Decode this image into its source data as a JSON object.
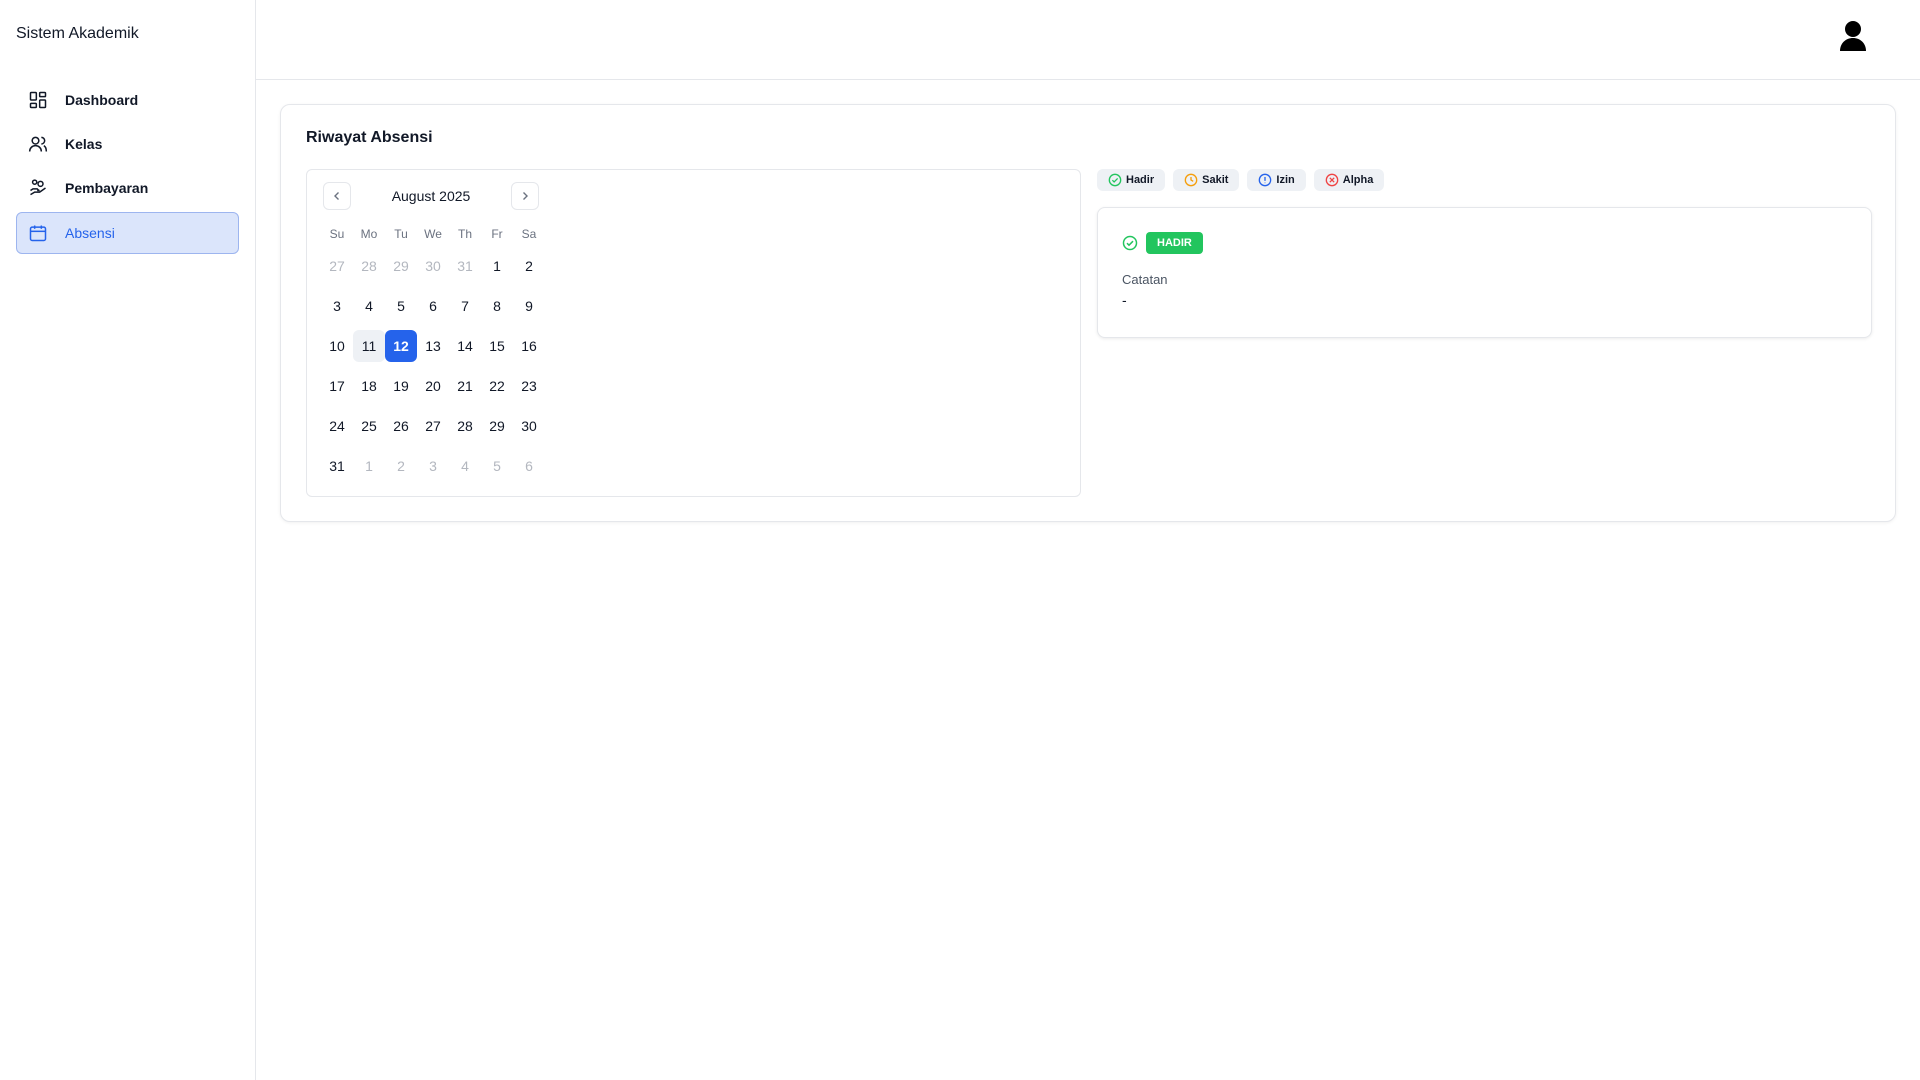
{
  "app": {
    "title": "Sistem Akademik"
  },
  "sidebar": {
    "items": [
      {
        "label": "Dashboard",
        "icon": "dashboard-grid-icon",
        "active": false
      },
      {
        "label": "Kelas",
        "icon": "users-icon",
        "active": false
      },
      {
        "label": "Pembayaran",
        "icon": "hand-coins-icon",
        "active": false
      },
      {
        "label": "Absensi",
        "icon": "calendar-icon",
        "active": true
      }
    ]
  },
  "header": {
    "avatar_icon": "user-avatar-icon"
  },
  "page": {
    "title": "Riwayat Absensi"
  },
  "calendar": {
    "month_label": "August 2025",
    "prev_icon": "chevron-left-icon",
    "next_icon": "chevron-right-icon",
    "weekdays": [
      "Su",
      "Mo",
      "Tu",
      "We",
      "Th",
      "Fr",
      "Sa"
    ],
    "weeks": [
      [
        {
          "d": "27",
          "o": true
        },
        {
          "d": "28",
          "o": true
        },
        {
          "d": "29",
          "o": true
        },
        {
          "d": "30",
          "o": true
        },
        {
          "d": "31",
          "o": true
        },
        {
          "d": "1"
        },
        {
          "d": "2"
        }
      ],
      [
        {
          "d": "3"
        },
        {
          "d": "4"
        },
        {
          "d": "5"
        },
        {
          "d": "6"
        },
        {
          "d": "7"
        },
        {
          "d": "8"
        },
        {
          "d": "9"
        }
      ],
      [
        {
          "d": "10"
        },
        {
          "d": "11",
          "today": true
        },
        {
          "d": "12",
          "selected": true
        },
        {
          "d": "13"
        },
        {
          "d": "14"
        },
        {
          "d": "15"
        },
        {
          "d": "16"
        }
      ],
      [
        {
          "d": "17"
        },
        {
          "d": "18"
        },
        {
          "d": "19"
        },
        {
          "d": "20"
        },
        {
          "d": "21"
        },
        {
          "d": "22"
        },
        {
          "d": "23"
        }
      ],
      [
        {
          "d": "24"
        },
        {
          "d": "25"
        },
        {
          "d": "26"
        },
        {
          "d": "27"
        },
        {
          "d": "28"
        },
        {
          "d": "29"
        },
        {
          "d": "30"
        }
      ],
      [
        {
          "d": "31"
        },
        {
          "d": "1",
          "o": true
        },
        {
          "d": "2",
          "o": true
        },
        {
          "d": "3",
          "o": true
        },
        {
          "d": "4",
          "o": true
        },
        {
          "d": "5",
          "o": true
        },
        {
          "d": "6",
          "o": true
        }
      ]
    ]
  },
  "legend": [
    {
      "label": "Hadir",
      "icon": "check-circle-icon",
      "color": "#22c55e"
    },
    {
      "label": "Sakit",
      "icon": "clock-icon",
      "color": "#f59e0b"
    },
    {
      "label": "Izin",
      "icon": "info-circle-icon",
      "color": "#2563eb"
    },
    {
      "label": "Alpha",
      "icon": "x-circle-icon",
      "color": "#ef4444"
    }
  ],
  "detail": {
    "status_badge": "HADIR",
    "status_color": "#22c55e",
    "note_label": "Catatan",
    "note_value": "-"
  },
  "colors": {
    "accent": "#2563eb",
    "success": "#22c55e"
  }
}
